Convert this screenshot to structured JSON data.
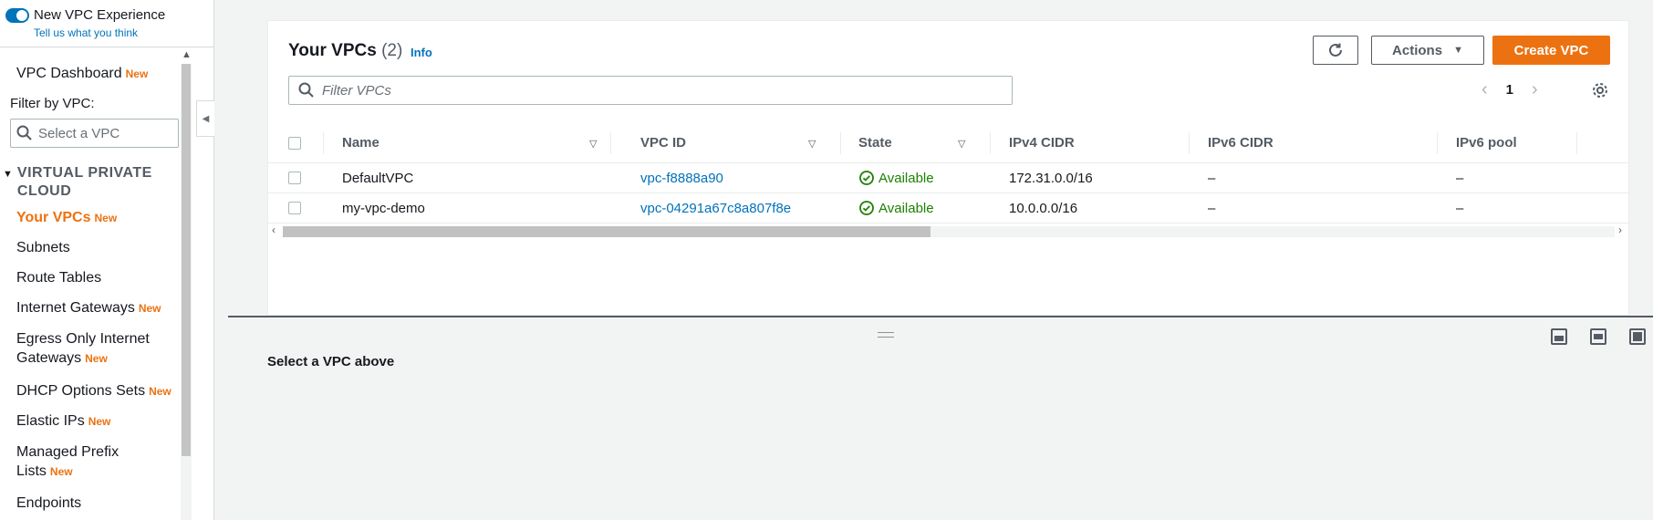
{
  "sidebar": {
    "toggle_label": "New VPC Experience",
    "feedback_link": "Tell us what you think",
    "dashboard": {
      "label": "VPC Dashboard",
      "badge": "New"
    },
    "filter_label": "Filter by VPC:",
    "filter_placeholder": "Select a VPC",
    "section_title": "VIRTUAL PRIVATE CLOUD",
    "items": [
      {
        "label": "Your VPCs",
        "badge": "New",
        "active": true
      },
      {
        "label": "Subnets",
        "badge": ""
      },
      {
        "label": "Route Tables",
        "badge": ""
      },
      {
        "label": "Internet Gateways",
        "badge": "New"
      },
      {
        "label": "Egress Only Internet",
        "label2": "Gateways",
        "badge": "New"
      },
      {
        "label": "DHCP Options Sets",
        "badge": "New"
      },
      {
        "label": "Elastic IPs",
        "badge": "New"
      },
      {
        "label": "Managed Prefix",
        "label2": "Lists",
        "badge": "New"
      },
      {
        "label": "Endpoints",
        "badge": ""
      }
    ]
  },
  "panel": {
    "title": "Your VPCs",
    "count": "(2)",
    "info": "Info",
    "actions_label": "Actions",
    "create_label": "Create VPC",
    "search_placeholder": "Filter VPCs",
    "page_number": "1"
  },
  "table": {
    "columns": [
      "Name",
      "VPC ID",
      "State",
      "IPv4 CIDR",
      "IPv6 CIDR",
      "IPv6 pool"
    ],
    "rows": [
      {
        "name": "DefaultVPC",
        "vpc_id": "vpc-f8888a90",
        "state": "Available",
        "ipv4": "172.31.0.0/16",
        "ipv6": "–",
        "pool": "–"
      },
      {
        "name": "my-vpc-demo",
        "vpc_id": "vpc-04291a67c8a807f8e",
        "state": "Available",
        "ipv4": "10.0.0.0/16",
        "ipv6": "–",
        "pool": "–"
      }
    ]
  },
  "detail": {
    "empty_text": "Select a VPC above"
  },
  "colors": {
    "accent": "#ec7211",
    "link": "#0073bb",
    "success": "#1d8102"
  },
  "icons": [
    "refresh-icon",
    "caret-down-icon",
    "search-icon",
    "chevron-left-icon",
    "chevron-right-icon",
    "gear-icon",
    "check-circle-icon",
    "sort-icon"
  ]
}
